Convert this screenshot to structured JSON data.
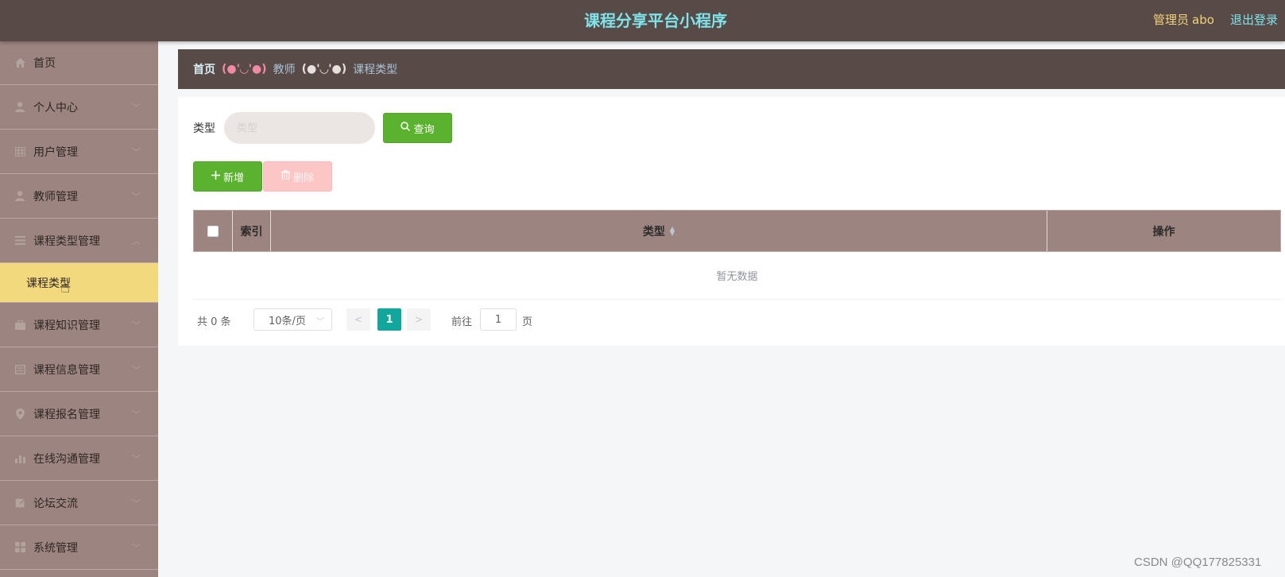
{
  "header": {
    "title": "课程分享平台小程序",
    "user_role": "管理员",
    "username": "abo",
    "logout_label": "退出登录"
  },
  "sidebar": {
    "items": [
      {
        "label": "首页",
        "icon": "home-icon"
      },
      {
        "label": "个人中心",
        "icon": "user-icon"
      },
      {
        "label": "用户管理",
        "icon": "grid-icon"
      },
      {
        "label": "教师管理",
        "icon": "user-icon"
      },
      {
        "label": "课程类型管理",
        "icon": "menu-icon",
        "expanded": true
      },
      {
        "label": "课程知识管理",
        "icon": "briefcase-icon"
      },
      {
        "label": "课程信息管理",
        "icon": "document-icon"
      },
      {
        "label": "课程报名管理",
        "icon": "location-icon"
      },
      {
        "label": "在线沟通管理",
        "icon": "bar-chart-icon"
      },
      {
        "label": "论坛交流",
        "icon": "edit-icon"
      },
      {
        "label": "系统管理",
        "icon": "apps-icon"
      }
    ],
    "active_subitem": "课程类型"
  },
  "breadcrumb": {
    "home": "首页",
    "separator1": "(●'◡'●)",
    "item1": "教师",
    "separator2": "(●'◡'●)",
    "item2": "课程类型"
  },
  "search": {
    "label": "类型",
    "placeholder": "类型",
    "query_button": "查询"
  },
  "actions": {
    "add_label": "新增",
    "delete_label": "删除"
  },
  "table": {
    "columns": [
      "索引",
      "类型",
      "操作"
    ],
    "empty_text": "暂无数据"
  },
  "pagination": {
    "total_text": "共 0 条",
    "page_size": "10条/页",
    "current_page": "1",
    "goto_label": "前往",
    "goto_value": "1",
    "page_unit": "页"
  },
  "watermark": "CSDN @QQ177825331",
  "colors": {
    "topbar": "#574a47",
    "sidebar": "#9c8580",
    "active_submenu": "#f2d97e",
    "title": "#7fe3ea",
    "primary_button": "#5ab22e",
    "delete_button": "#fdc6c6",
    "current_page": "#11a79c"
  }
}
